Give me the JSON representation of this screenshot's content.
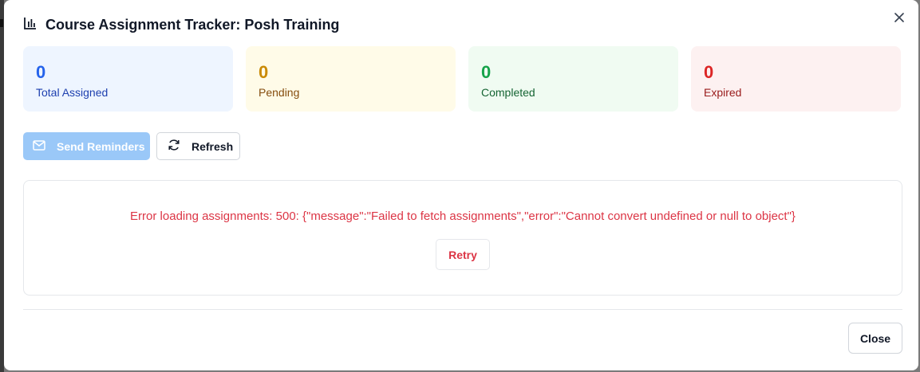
{
  "modal": {
    "title": "Course Assignment Tracker: Posh Training",
    "title_icon": "bar-chart-icon",
    "close_icon": "close-icon"
  },
  "stats": [
    {
      "value": "0",
      "label": "Total Assigned",
      "bg": "#eef5ff",
      "num_color": "#2563eb",
      "label_color": "#1e40af"
    },
    {
      "value": "0",
      "label": "Pending",
      "bg": "#fffbe8",
      "num_color": "#ca8a04",
      "label_color": "#854d0e"
    },
    {
      "value": "0",
      "label": "Completed",
      "bg": "#f0fbf2",
      "num_color": "#16a34a",
      "label_color": "#166534"
    },
    {
      "value": "0",
      "label": "Expired",
      "bg": "#fdf1f1",
      "num_color": "#dc2626",
      "label_color": "#991b1b"
    }
  ],
  "actions": {
    "send_reminders_label": "Send Reminders",
    "send_reminders_icon": "mail-icon",
    "refresh_label": "Refresh",
    "refresh_icon": "refresh-icon"
  },
  "error": {
    "message": "Error loading assignments: 500: {\"message\":\"Failed to fetch assignments\",\"error\":\"Cannot convert undefined or null to object\"}",
    "retry_label": "Retry",
    "color": "#dc3545"
  },
  "footer": {
    "close_label": "Close"
  }
}
